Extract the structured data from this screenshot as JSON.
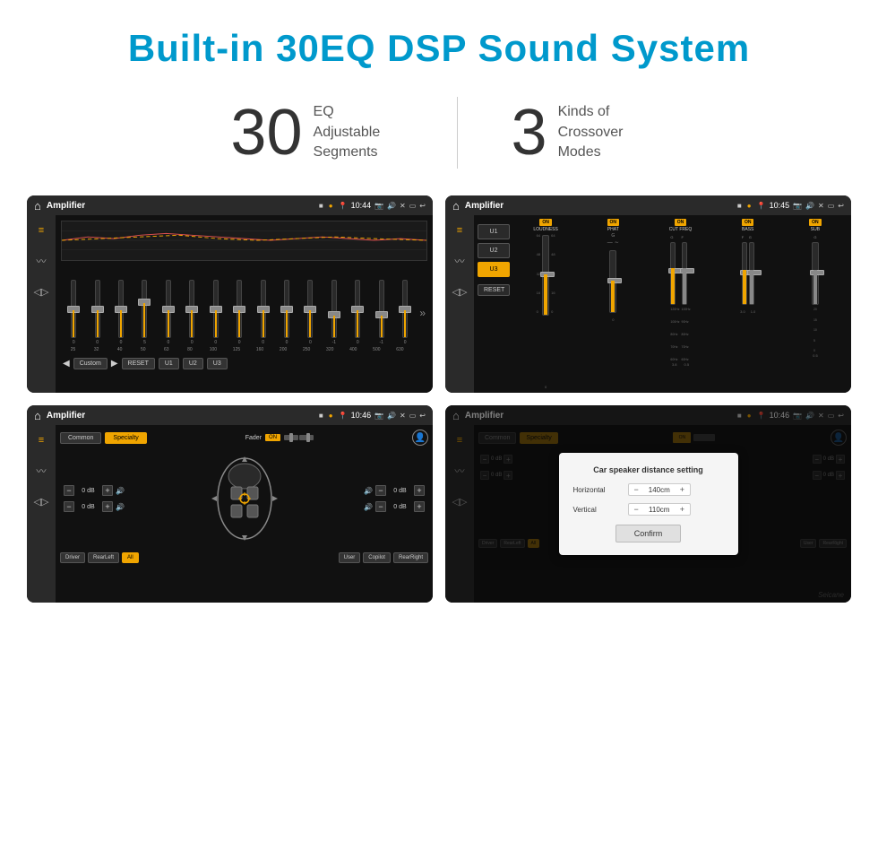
{
  "page": {
    "title": "Built-in 30EQ DSP Sound System",
    "stats": [
      {
        "number": "30",
        "label": "EQ Adjustable\nSegments"
      },
      {
        "number": "3",
        "label": "Kinds of\nCrossover Modes"
      }
    ]
  },
  "screens": [
    {
      "id": "eq-screen",
      "title": "Amplifier",
      "time": "10:44",
      "type": "eq"
    },
    {
      "id": "crossover-screen",
      "title": "Amplifier",
      "time": "10:45",
      "type": "crossover"
    },
    {
      "id": "specialty-screen",
      "title": "Amplifier",
      "time": "10:46",
      "type": "specialty"
    },
    {
      "id": "distance-screen",
      "title": "Amplifier",
      "time": "10:46",
      "type": "distance"
    }
  ],
  "eq": {
    "freqs": [
      "25",
      "32",
      "40",
      "50",
      "63",
      "80",
      "100",
      "125",
      "160",
      "200",
      "250",
      "320",
      "400",
      "500",
      "630"
    ],
    "values": [
      "0",
      "0",
      "0",
      "5",
      "0",
      "0",
      "0",
      "0",
      "0",
      "0",
      "0",
      "-1",
      "0",
      "-1",
      "0"
    ],
    "presets": [
      "Custom",
      "RESET",
      "U1",
      "U2",
      "U3"
    ]
  },
  "crossover": {
    "presets": [
      "U1",
      "U2",
      "U3"
    ],
    "activePreset": "U3",
    "channels": [
      {
        "label": "LOUDNESS",
        "on": true
      },
      {
        "label": "PHAT",
        "on": true
      },
      {
        "label": "CUT FREQ",
        "on": true
      },
      {
        "label": "BASS",
        "on": true
      },
      {
        "label": "SUB",
        "on": true
      }
    ]
  },
  "specialty": {
    "tabs": [
      "Common",
      "Specialty"
    ],
    "activeTab": "Specialty",
    "fader": {
      "label": "Fader",
      "on": true
    },
    "volumes": [
      "0 dB",
      "0 dB",
      "0 dB",
      "0 dB"
    ],
    "speakerBtns": [
      "Driver",
      "RearLeft",
      "All",
      "User",
      "Copilot",
      "RearRight"
    ],
    "activeBtn": "All"
  },
  "dialog": {
    "title": "Car speaker distance setting",
    "horizontal_label": "Horizontal",
    "horizontal_value": "140cm",
    "vertical_label": "Vertical",
    "vertical_value": "110cm",
    "confirm_label": "Confirm"
  },
  "watermark": "Seicane"
}
